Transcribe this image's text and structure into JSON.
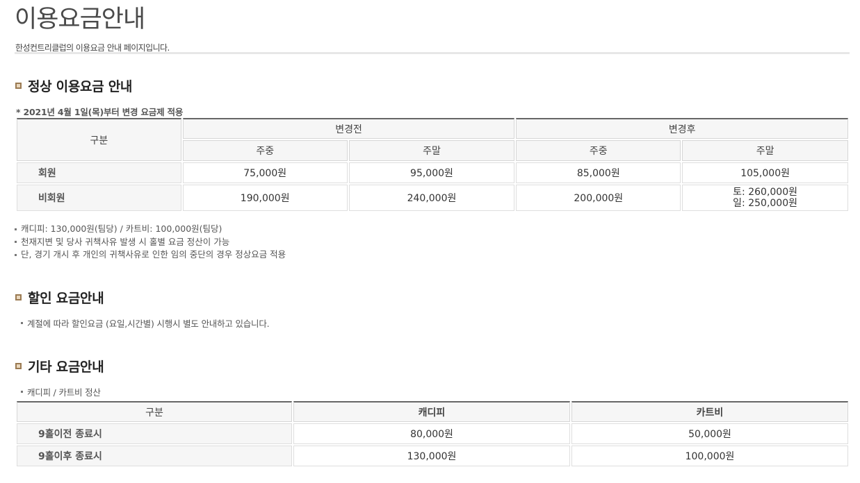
{
  "header": {
    "title": "이용요금안내",
    "subtitle": "한성컨트리클럽의 이용요금 안내 페이지입니다."
  },
  "colors": {
    "accent_square": "#9a7a52",
    "table_header_bg": "#f6f6f6",
    "table_top_border": "#666666"
  },
  "icons": {
    "section_bullet": "square-bullet-icon"
  },
  "regular": {
    "title": "정상 이용요금 안내",
    "effective_note": "* 2021년 4월 1일(목)부터 변경 요금제 적용",
    "table": {
      "category_header": "구분",
      "before_header": "변경전",
      "after_header": "변경후",
      "sub_headers": [
        "주중",
        "주말",
        "주중",
        "주말"
      ],
      "rows": [
        {
          "label": "회원",
          "cells": [
            "75,000원",
            "95,000원",
            "85,000원",
            "105,000원"
          ]
        },
        {
          "label": "비회원",
          "cells": [
            "190,000원",
            "240,000원",
            "200,000원"
          ],
          "weekend_after_lines": [
            "토: 260,000원",
            "일: 250,000원"
          ]
        }
      ]
    },
    "notes": [
      "캐디피: 130,000원(팀당) / 카트비: 100,000원(팀당)",
      "천재지변 및 당사 귀책사유 발생 시 홀별 요금 정산이 가능",
      "단, 경기 개시 후 개인의 귀책사유로 인한 임의 중단의 경우 정상요금 적용"
    ]
  },
  "discount": {
    "title": "할인 요금안내",
    "note": "계절에 따라 할인요금 (요일,시간별) 시행시 별도 안내하고 있습니다."
  },
  "other": {
    "title": "기타 요금안내",
    "note": "캐디피 / 카트비 정산",
    "table": {
      "headers": [
        "구분",
        "캐디피",
        "카트비"
      ],
      "rows": [
        {
          "label": "9홀이전 종료시",
          "cells": [
            "80,000원",
            "50,000원"
          ]
        },
        {
          "label": "9홀이후 종료시",
          "cells": [
            "130,000원",
            "100,000원"
          ]
        }
      ]
    }
  }
}
